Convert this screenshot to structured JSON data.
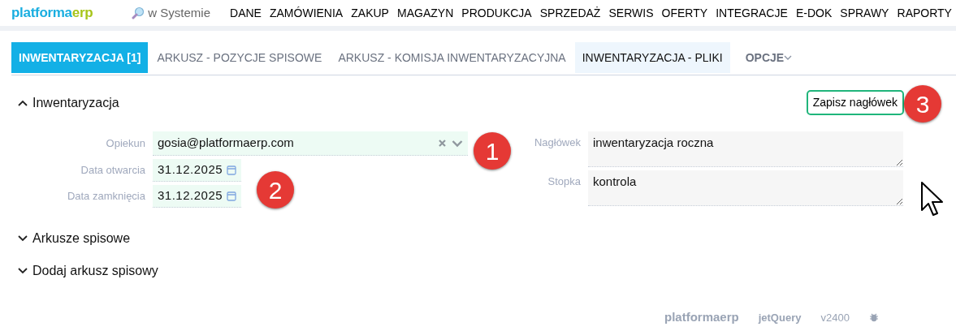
{
  "logo": {
    "main": "platforma",
    "accent": "erp"
  },
  "search": {
    "label": "w Systemie"
  },
  "menu": [
    "DANE",
    "ZAMÓWIENIA",
    "ZAKUP",
    "MAGAZYN",
    "PRODUKCJA",
    "SPRZEDAŻ",
    "SERWIS",
    "OFERTY",
    "INTEGRACJE",
    "E-DOK",
    "SPRAWY",
    "RAPORTY"
  ],
  "tabs": [
    {
      "label": "INWENTARYZACJA [1]",
      "selected": true,
      "hover": false
    },
    {
      "label": "ARKUSZ - POZYCJE SPISOWE",
      "selected": false,
      "hover": false
    },
    {
      "label": "ARKUSZ - KOMISJA INWENTARYZACYJNA",
      "selected": false,
      "hover": false
    },
    {
      "label": "INWENTARYZACJA - PLIKI",
      "selected": false,
      "hover": true
    },
    {
      "label": "OPCJE",
      "selected": false,
      "hover": false,
      "kind": "dropdown"
    }
  ],
  "sections": [
    {
      "title": "Inwentaryzacja",
      "expanded": true
    },
    {
      "title": "Arkusze spisowe",
      "expanded": false
    },
    {
      "title": "Dodaj arkusz spisowy",
      "expanded": false
    }
  ],
  "save_button": "Zapisz nagłówek",
  "left_fields": [
    {
      "label": "Opiekun",
      "value": "gosia@platformaerp.com",
      "kind": "select"
    },
    {
      "label": "Data otwarcia",
      "value": "31.12.2025",
      "kind": "date"
    },
    {
      "label": "Data zamknięcia",
      "value": "31.12.2025",
      "kind": "date"
    }
  ],
  "right_fields": [
    {
      "label": "Nagłówek",
      "value": "inwentaryzacja roczna"
    },
    {
      "label": "Stopka",
      "value": "kontrola"
    }
  ],
  "markers": [
    "1",
    "2",
    "3"
  ],
  "footer": {
    "logo": {
      "main": "platforma",
      "accent": "erp"
    },
    "library": "jetQuery",
    "version": "v2400"
  }
}
